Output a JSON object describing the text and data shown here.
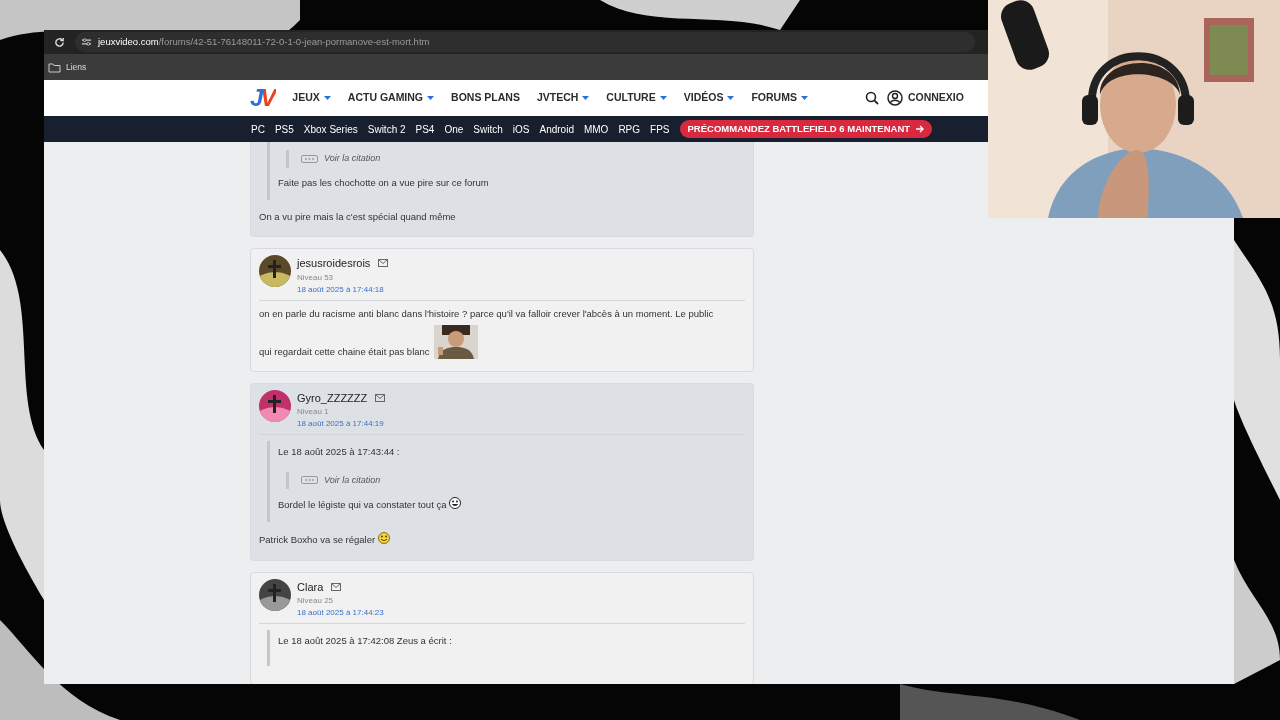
{
  "browser": {
    "url": "**jeuxvideo.com**/forums/42-51-76148011-72-0-1-0-jean-pormanove-est-mort.htm",
    "bookmarks": [
      {
        "label": "Liens"
      }
    ]
  },
  "site": {
    "logo": "JV",
    "menu": [
      {
        "label": "JEUX",
        "has_menu": true
      },
      {
        "label": "ACTU GAMING",
        "has_menu": true
      },
      {
        "label": "BONS PLANS",
        "has_menu": false
      },
      {
        "label": "JVTECH",
        "has_menu": true
      },
      {
        "label": "CULTURE",
        "has_menu": true
      },
      {
        "label": "VIDÉOS",
        "has_menu": true
      },
      {
        "label": "FORUMS",
        "has_menu": true
      }
    ],
    "account": "CONNEXIO",
    "platforms": [
      "PC",
      "PS5",
      "Xbox Series",
      "Switch 2",
      "PS4",
      "One",
      "Switch",
      "iOS",
      "Android",
      "MMO",
      "RPG",
      "FPS"
    ],
    "promo": "PRÉCOMMANDEZ BATTLEFIELD 6 MAINTENANT"
  },
  "posts": [
    {
      "shaded": true,
      "quote": {
        "nested": "Voir la citation",
        "lines": [
          [
            {
              "kind": "text",
              "text": "Faite pas les chochotte on a vue pire sur ce forum"
            }
          ]
        ]
      },
      "lines": [
        [
          {
            "kind": "text",
            "text": "On a vu pire mais la c'est spécial quand même"
          }
        ]
      ]
    },
    {
      "shaded": false,
      "author": "jesusroidesrois",
      "level": "Niveau 53",
      "date": "18 août 2025 à 17:44:18",
      "lines": [
        [
          {
            "kind": "text",
            "text": "on en parle du racisme anti blanc dans l'histoire ? parce qu'il va falloir crever l'abcès à un moment. Le public"
          }
        ],
        [
          {
            "kind": "text",
            "text": "qui regardait cette chaine était pas blanc"
          },
          {
            "kind": "sticker"
          }
        ]
      ]
    },
    {
      "shaded": true,
      "author": "Gyro_ZZZZZZ",
      "level": "Niveau 1",
      "date": "18 août 2025 à 17:44:19",
      "quote": {
        "header": "Le 18 août 2025 à 17:43:44 :",
        "nested": "Voir la citation",
        "lines": [
          [
            {
              "kind": "text",
              "text": "Bordel le légiste qui va constater tout ça"
            },
            {
              "kind": "grin"
            }
          ]
        ]
      },
      "lines": [
        [
          {
            "kind": "text",
            "text": "Patrick Boxho va se régaler"
          },
          {
            "kind": "smile"
          }
        ]
      ]
    },
    {
      "shaded": false,
      "author": "Clara",
      "level": "Niveau 25",
      "date": "18 août 2025 à 17:44:23",
      "quote": {
        "header": "Le 18 août 2025 à 17:42:08 Zeus a écrit :"
      }
    }
  ]
}
